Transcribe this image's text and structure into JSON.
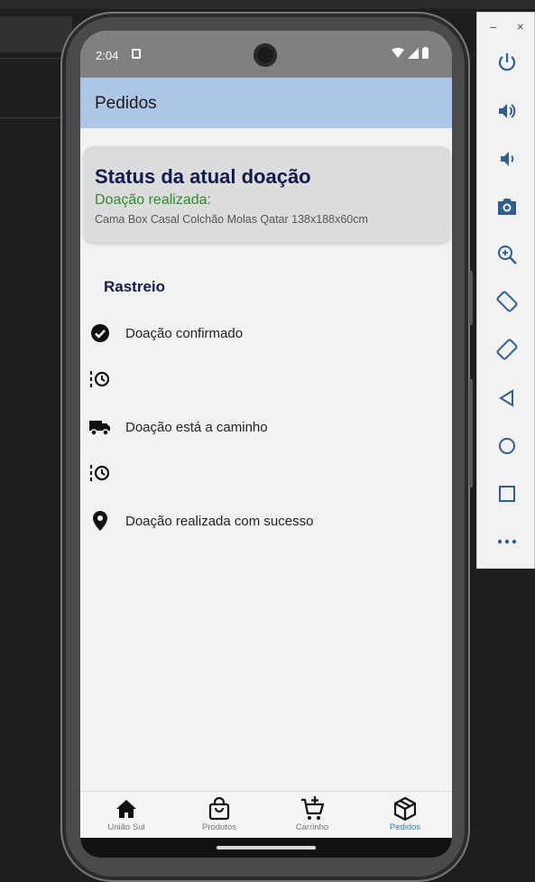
{
  "status_bar": {
    "time": "2:04"
  },
  "app_bar": {
    "title": "Pedidos"
  },
  "status_card": {
    "heading": "Status da atual doação",
    "subheading": "Doação realizada:",
    "product": "Cama Box Casal Colchão Molas Qatar 138x188x60cm"
  },
  "tracking": {
    "title": "Rastreio",
    "steps": [
      {
        "icon": "check-circle-icon",
        "label": "Doação confirmado"
      },
      {
        "icon": "pending-clock-icon",
        "label": ""
      },
      {
        "icon": "truck-icon",
        "label": "Doação está a caminho"
      },
      {
        "icon": "pending-clock-icon",
        "label": ""
      },
      {
        "icon": "location-pin-icon",
        "label": "Doação realizada com sucesso"
      }
    ]
  },
  "bottom_nav": {
    "items": [
      {
        "label": "União Sul",
        "icon": "home-icon"
      },
      {
        "label": "Produtos",
        "icon": "shopping-bag-icon"
      },
      {
        "label": "Carrinho",
        "icon": "cart-add-icon"
      },
      {
        "label": "Pedidos",
        "icon": "package-icon"
      }
    ],
    "active": "Pedidos",
    "active_color": "#2b7cd3"
  },
  "emulator_panel": {
    "minimize": "–",
    "close": "×",
    "buttons": [
      "power-icon",
      "volume-up-icon",
      "volume-down-icon",
      "camera-icon",
      "zoom-icon",
      "rotate-left-icon",
      "rotate-right-icon",
      "back-icon",
      "home-circle-icon",
      "overview-icon",
      "more-icon"
    ]
  },
  "colors": {
    "app_bar": "#aec6e6",
    "heading_text": "#121a4e",
    "success_text": "#2e8b2e"
  }
}
